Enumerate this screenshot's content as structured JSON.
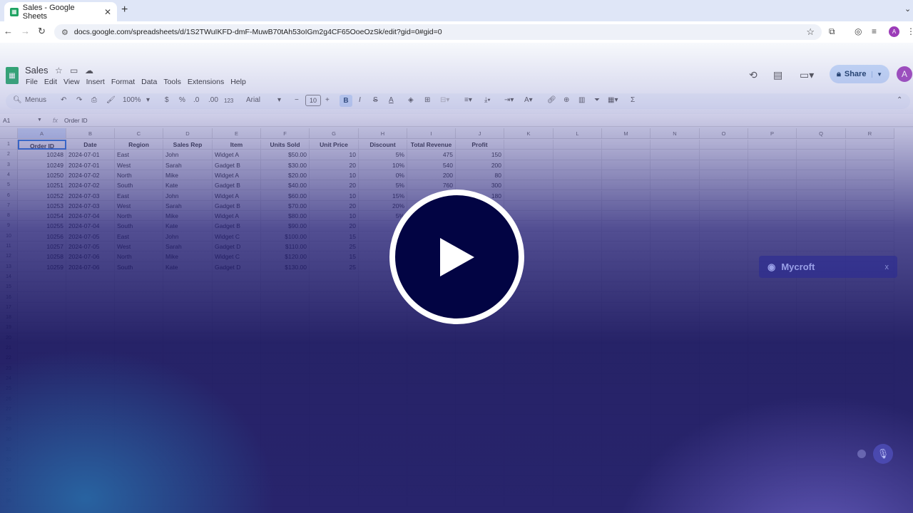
{
  "browser": {
    "tab_title": "Sales - Google Sheets",
    "url": "docs.google.com/spreadsheets/d/1S2TWuIKFD-dmF-MuwB70tAh53oIGm2g4CF65OoeOzSk/edit?gid=0#gid=0",
    "profile_initial": "A"
  },
  "sheets": {
    "doc_title": "Sales",
    "menu": [
      "File",
      "Edit",
      "View",
      "Insert",
      "Format",
      "Data",
      "Tools",
      "Extensions",
      "Help"
    ],
    "share_label": "Share",
    "account_initial": "A",
    "toolbar": {
      "menus_label": "Menus",
      "zoom": "100%",
      "currency": "$",
      "percent": "%",
      "dec_decrease": ".0",
      "dec_increase": ".00",
      "number_format": "123",
      "font": "Arial",
      "font_size": "10",
      "bold": "B",
      "italic": "I",
      "text_color": "A",
      "sum": "Σ"
    },
    "name_box": "A1",
    "fx_label": "fx",
    "formula_value": "Order ID",
    "column_letters": [
      "A",
      "B",
      "C",
      "D",
      "E",
      "F",
      "G",
      "H",
      "I",
      "J",
      "K",
      "L",
      "M",
      "N",
      "O",
      "P",
      "Q",
      "R"
    ],
    "row_numbers": [
      "1",
      "2",
      "3",
      "4",
      "5",
      "6",
      "7",
      "8",
      "9",
      "10",
      "11",
      "12",
      "13",
      "14",
      "15",
      "16",
      "17",
      "18",
      "19",
      "20",
      "21",
      "22",
      "23",
      "24",
      "25",
      "26",
      "27",
      "28",
      "29",
      "30",
      "31",
      "32",
      "33",
      "34",
      "35",
      "36"
    ],
    "headers": [
      "Order ID",
      "Date",
      "Region",
      "Sales Rep",
      "Item",
      "Units Sold",
      "Unit Price",
      "Discount",
      "Total Revenue",
      "Profit"
    ],
    "rows": [
      [
        "10248",
        "2024-07-01",
        "East",
        "John",
        "Widget A",
        "$50.00",
        "10",
        "5%",
        "475",
        "150"
      ],
      [
        "10249",
        "2024-07-01",
        "West",
        "Sarah",
        "Gadget B",
        "$30.00",
        "20",
        "10%",
        "540",
        "200"
      ],
      [
        "10250",
        "2024-07-02",
        "North",
        "Mike",
        "Widget A",
        "$20.00",
        "10",
        "0%",
        "200",
        "80"
      ],
      [
        "10251",
        "2024-07-02",
        "South",
        "Kate",
        "Gadget B",
        "$40.00",
        "20",
        "5%",
        "760",
        "300"
      ],
      [
        "10252",
        "2024-07-03",
        "East",
        "John",
        "Widget A",
        "$60.00",
        "10",
        "15%",
        "",
        "180"
      ],
      [
        "10253",
        "2024-07-03",
        "West",
        "Sarah",
        "Gadget B",
        "$70.00",
        "20",
        "20%",
        "",
        ""
      ],
      [
        "10254",
        "2024-07-04",
        "North",
        "Mike",
        "Widget A",
        "$80.00",
        "10",
        "5%",
        "",
        ""
      ],
      [
        "10255",
        "2024-07-04",
        "South",
        "Kate",
        "Gadget B",
        "$90.00",
        "20",
        "",
        "",
        ""
      ],
      [
        "10256",
        "2024-07-05",
        "East",
        "John",
        "Widget C",
        "$100.00",
        "15",
        "",
        "",
        ""
      ],
      [
        "10257",
        "2024-07-05",
        "West",
        "Sarah",
        "Gadget D",
        "$110.00",
        "25",
        "",
        "",
        ""
      ],
      [
        "10258",
        "2024-07-06",
        "North",
        "Mike",
        "Widget C",
        "$120.00",
        "15",
        "",
        "",
        ""
      ],
      [
        "10259",
        "2024-07-06",
        "South",
        "Kate",
        "Gadget D",
        "$130.00",
        "25",
        "",
        "",
        ""
      ]
    ]
  },
  "overlay": {
    "assistant_name": "Mycroft",
    "close_label": "x"
  }
}
